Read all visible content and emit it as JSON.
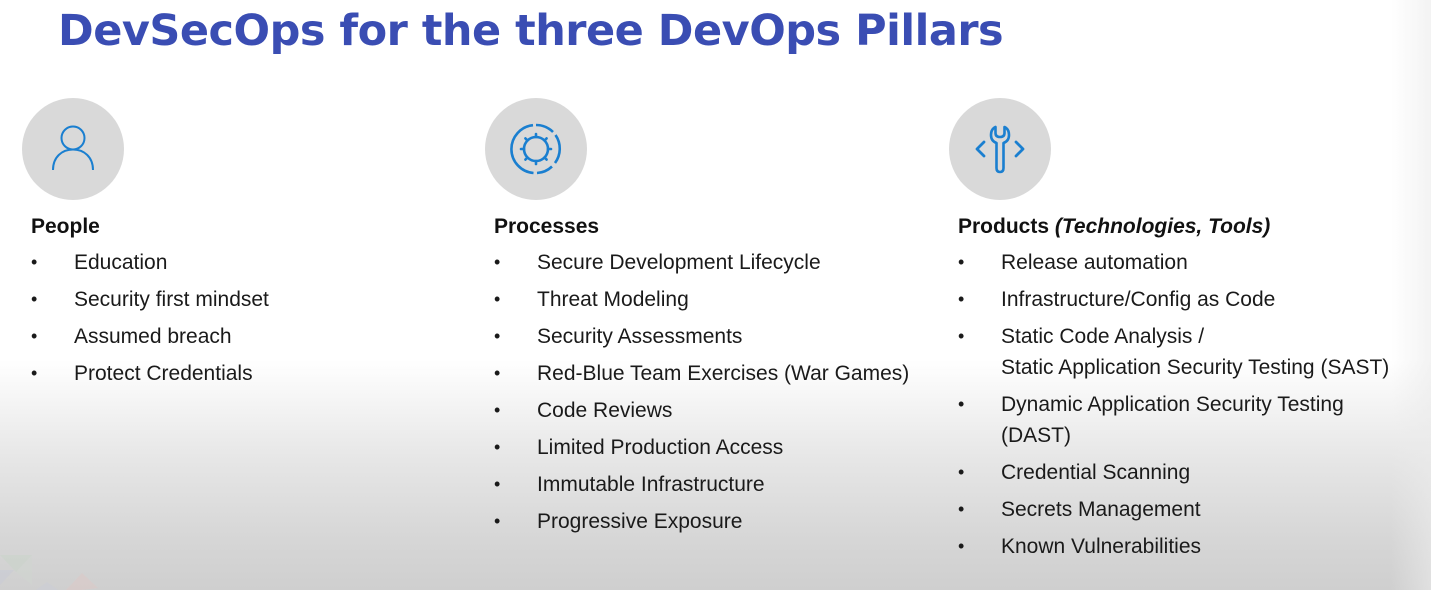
{
  "slide": {
    "title": "DevSecOps for the three DevOps Pillars",
    "colors": {
      "title": "#3a4db3",
      "icon": "#1a7fd0",
      "icon_circle": "#d9d9d9",
      "text": "#1a1a1a"
    },
    "pillars": [
      {
        "icon": "person-icon",
        "heading": "People",
        "heading_sub": "",
        "items": [
          {
            "lines": [
              "Education"
            ]
          },
          {
            "lines": [
              "Security first mindset"
            ]
          },
          {
            "lines": [
              "Assumed breach"
            ]
          },
          {
            "lines": [
              "Protect Credentials"
            ]
          }
        ]
      },
      {
        "icon": "gear-cycle-icon",
        "heading": "Processes",
        "heading_sub": "",
        "items": [
          {
            "lines": [
              "Secure Development Lifecycle"
            ]
          },
          {
            "lines": [
              "Threat Modeling"
            ]
          },
          {
            "lines": [
              "Security Assessments"
            ]
          },
          {
            "lines": [
              "Red-Blue Team Exercises (War Games)"
            ]
          },
          {
            "lines": [
              "Code Reviews"
            ]
          },
          {
            "lines": [
              "Limited Production Access"
            ]
          },
          {
            "lines": [
              "Immutable Infrastructure"
            ]
          },
          {
            "lines": [
              "Progressive Exposure"
            ]
          }
        ]
      },
      {
        "icon": "wrench-code-icon",
        "heading": "Products",
        "heading_sub": "(Technologies, Tools)",
        "items": [
          {
            "lines": [
              "Release automation"
            ]
          },
          {
            "lines": [
              "Infrastructure/Config as Code"
            ]
          },
          {
            "lines": [
              "Static Code Analysis /",
              "Static Application Security Testing (SAST)"
            ]
          },
          {
            "lines": [
              "Dynamic Application Security Testing",
              "(DAST)"
            ]
          },
          {
            "lines": [
              "Credential Scanning"
            ]
          },
          {
            "lines": [
              "Secrets Management"
            ]
          },
          {
            "lines": [
              "Known Vulnerabilities"
            ]
          }
        ]
      }
    ],
    "bullet_glyph": "•"
  }
}
